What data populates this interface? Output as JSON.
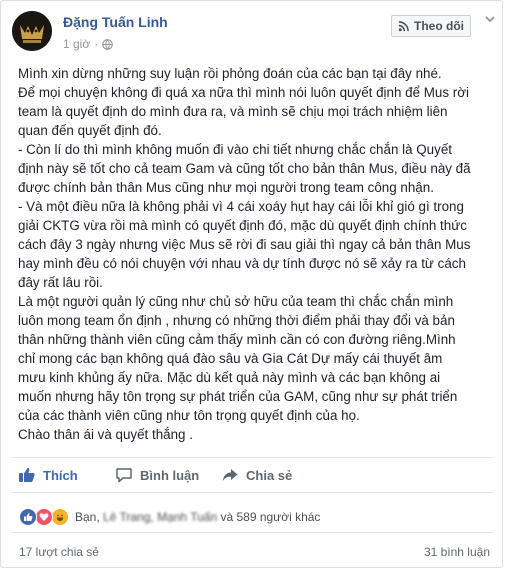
{
  "post": {
    "author": "Đặng Tuấn Linh",
    "time": "1 giờ",
    "time_separator": "·",
    "follow_label": "Theo dõi",
    "more_icon": "chevron-down-icon",
    "paragraphs": [
      "Mình xin dừng những suy luận rồi phỏng đoán của các bạn tại đây nhé.",
      "Để mọi chuyện không đi quá xa nữa thì mình nói luôn quyết định để Mus rời",
      "team là quyết định do mình đưa ra, và mình sẽ chịu mọi trách nhiệm liên",
      "quan đến quyết định đó.",
      "- Còn lí do thì mình không muốn đi vào chi tiết nhưng chắc chắn là Quyết",
      "định này sẽ tốt cho cả team Gam và cũng tốt cho bản thân Mus, điều này đã",
      "được chính bản thân Mus cũng như mọi người trong team công nhận.",
      "- Và một điều nữa là không phải vì 4 cái xoáy hụt hay cái lỗi khỉ gió gì trong",
      "giải CKTG vừa rồi mà mình có quyết định đó, mặc dù quyết định chính thức",
      "cách đây 3 ngày nhưng việc Mus sẽ rời đi sau giải thì ngay cả bản thân Mus",
      "hay mình đều có nói chuyện với nhau và dự tính được nó sẽ xảy ra từ cách",
      "đây rất lâu rồi.",
      "Là một người quản lý cũng như chủ sở hữu của team thì chắc chắn mình",
      "luôn mong team ổn định , nhưng có những thời điểm phải thay đổi và bản",
      "thân những thành viên cũng cảm thấy mình cần có con đường riêng.Mình",
      "chỉ mong các bạn không quá đào sâu và Gia Cát Dự mấy cái thuyết âm",
      "mưu kinh khủng ấy nữa. Mặc dù kết quả này mình và các bạn không ai",
      "muốn nhưng hãy tôn trọng sự phát triển của GAM, cũng như sự phát triển",
      "của các thành viên cũng như tôn trọng quyết định của họ.",
      "Chào thân ái và quyết thắng ."
    ]
  },
  "actions": {
    "like": "Thích",
    "comment": "Bình luận",
    "share": "Chia sẻ"
  },
  "reactions": {
    "prefix": "Bạn,",
    "blurred_name_1": "Lê Trang,",
    "blurred_name_2": "Mạnh Tuấn",
    "suffix": "và 589 người khác"
  },
  "stats": {
    "shares": "17 lượt chia sẻ",
    "comments": "31 bình luận"
  },
  "colors": {
    "link": "#385898",
    "like_blue": "#4267b2",
    "text": "#1d2129",
    "muted": "#90949c"
  }
}
